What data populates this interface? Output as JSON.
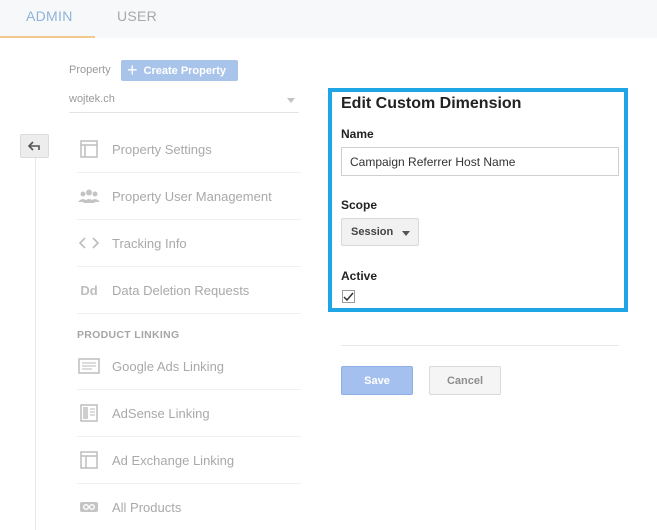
{
  "tabs": [
    {
      "label": "ADMIN"
    },
    {
      "label": "USER"
    }
  ],
  "property": {
    "label": "Property",
    "create_button": "Create Property",
    "selected": "wojtek.ch"
  },
  "nav": {
    "items": [
      {
        "label": "Property Settings",
        "icon": "window-icon"
      },
      {
        "label": "Property User Management",
        "icon": "users-icon"
      },
      {
        "label": "Tracking Info",
        "icon": "code-icon"
      },
      {
        "label": "Data Deletion Requests",
        "icon": "dd-icon",
        "icon_text": "Dd"
      }
    ],
    "section_title": "PRODUCT LINKING",
    "linking_items": [
      {
        "label": "Google Ads Linking",
        "icon": "ads-icon"
      },
      {
        "label": "AdSense Linking",
        "icon": "adsense-icon"
      },
      {
        "label": "Ad Exchange Linking",
        "icon": "adexchange-icon"
      },
      {
        "label": "All Products",
        "icon": "link-icon"
      }
    ]
  },
  "edit_panel": {
    "title": "Edit Custom Dimension",
    "name_label": "Name",
    "name_value": "Campaign Referrer Host Name",
    "scope_label": "Scope",
    "scope_value": "Session",
    "active_label": "Active",
    "active_checked": true
  },
  "actions": {
    "save": "Save",
    "cancel": "Cancel"
  },
  "colors": {
    "accent": "#1ea5e6",
    "button_blue": "#a9c4ea"
  }
}
